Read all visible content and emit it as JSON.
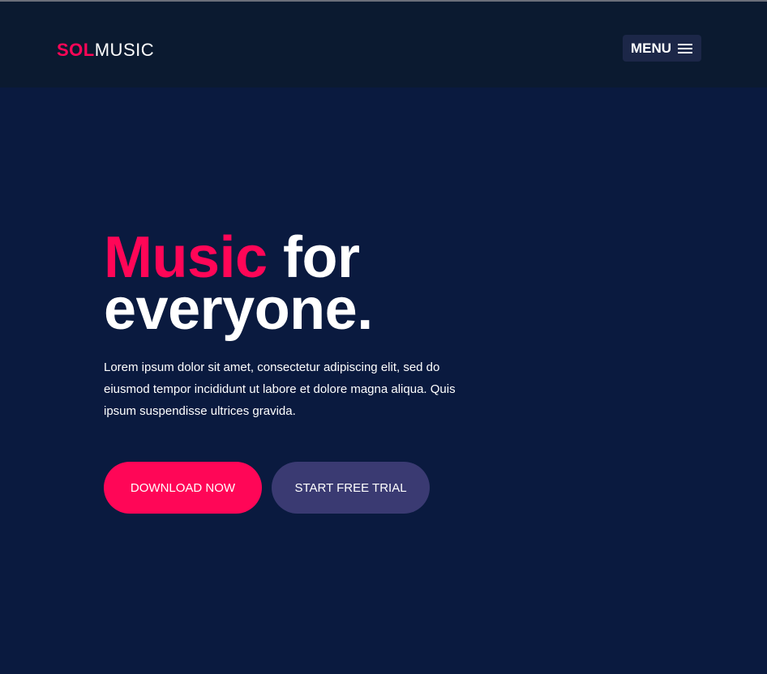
{
  "header": {
    "logo_part1": "SOL",
    "logo_part2": "MUSIC",
    "menu_label": "MENU"
  },
  "hero": {
    "title_accent": "Music",
    "title_rest_line1": " for",
    "title_line2": "everyone.",
    "description": "Lorem ipsum dolor sit amet, consectetur adipiscing elit, sed do eiusmod tempor incididunt ut labore et dolore magna aliqua. Quis ipsum suspendisse ultrices gravida.",
    "primary_button": "DOWNLOAD NOW",
    "secondary_button": "START FREE TRIAL"
  },
  "colors": {
    "accent": "#ff0657",
    "background": "#0a1a3f",
    "header_bg": "#0b1a30",
    "secondary_button": "#3a3a72"
  },
  "icons": {
    "menu": "hamburger-icon"
  }
}
